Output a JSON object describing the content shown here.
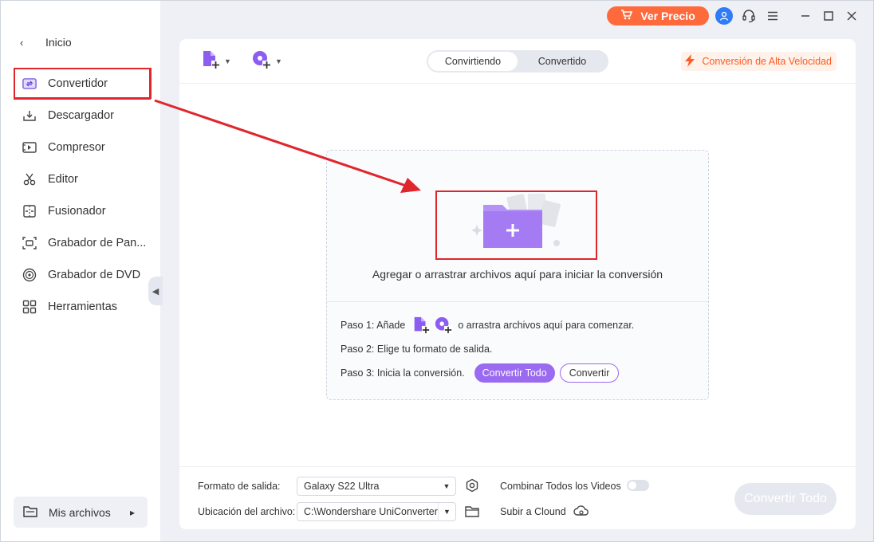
{
  "sidebar": {
    "back_label": "Inicio",
    "items": [
      {
        "label": "Convertidor",
        "icon": "converter-icon",
        "active": true
      },
      {
        "label": "Descargador",
        "icon": "download-icon"
      },
      {
        "label": "Compresor",
        "icon": "compress-icon"
      },
      {
        "label": "Editor",
        "icon": "scissors-icon"
      },
      {
        "label": "Fusionador",
        "icon": "merge-icon"
      },
      {
        "label": "Grabador de Pan...",
        "icon": "screen-record-icon"
      },
      {
        "label": "Grabador de DVD",
        "icon": "disc-icon"
      },
      {
        "label": "Herramientas",
        "icon": "grid-icon"
      }
    ],
    "my_files": "Mis archivos"
  },
  "topbar": {
    "promo_label": "Ver Precio"
  },
  "toolbar": {
    "tabs": [
      "Convirtiendo",
      "Convertido"
    ],
    "active_tab": "Convirtiendo",
    "speed_label": "Conversión de Alta Velocidad"
  },
  "dropzone": {
    "text": "Agregar o arrastrar archivos aquí para iniciar la conversión",
    "step1_prefix": "Paso 1: Añade",
    "step1_suffix": "o arrastra archivos aquí para comenzar.",
    "step2": "Paso 2: Elige tu formato de salida.",
    "step3": "Paso 3: Inicia la conversión.",
    "convert_all_pill": "Convertir Todo",
    "convert_pill": "Convertir"
  },
  "footer": {
    "format_label": "Formato de salida:",
    "format_value": "Galaxy S22 Ultra",
    "location_label": "Ubicación del archivo:",
    "location_value": "C:\\Wondershare UniConverter",
    "merge_label": "Combinar Todos los Videos",
    "merge_enabled": false,
    "upload_label": "Subir a Clound",
    "convert_all_button": "Convertir Todo"
  },
  "colors": {
    "accent": "#9a6af0",
    "promo": "#ff6a3d",
    "speed": "#ff5a1f",
    "annotation": "#e0262d"
  }
}
